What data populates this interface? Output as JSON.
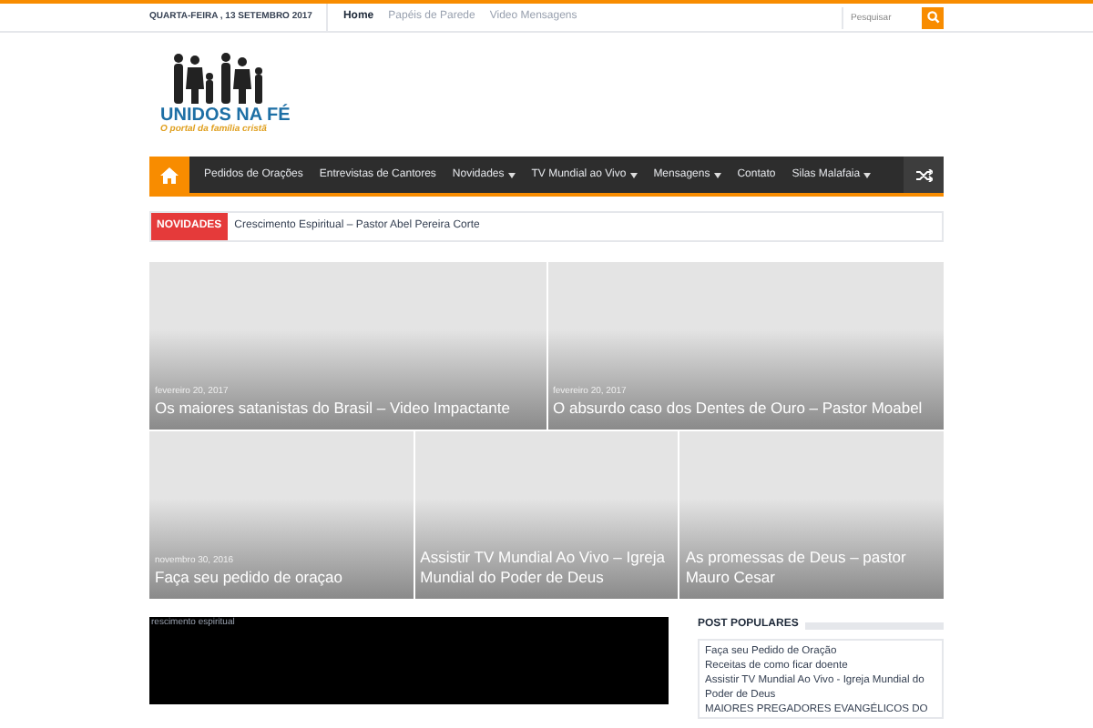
{
  "top_bar": {
    "date": "QUARTA-FEIRA , 13 SETEMBRO 2017",
    "links": [
      {
        "label": "Home",
        "selected": true
      },
      {
        "label": "Papéis de Parede",
        "selected": false
      },
      {
        "label": "Video Mensagens",
        "selected": false
      }
    ],
    "search": {
      "placeholder": "Pesquisar"
    }
  },
  "logo": {
    "title": "UNIDOS NA FÉ",
    "tagline": "O portal da família cristã"
  },
  "nav": {
    "items": [
      {
        "label": "Pedidos de Orações",
        "dropdown": false
      },
      {
        "label": "Entrevistas de Cantores",
        "dropdown": false
      },
      {
        "label": "Novidades",
        "dropdown": true
      },
      {
        "label": "TV Mundial ao Vivo",
        "dropdown": true
      },
      {
        "label": "Mensagens",
        "dropdown": true
      },
      {
        "label": "Contato",
        "dropdown": false
      },
      {
        "label": "Silas Malafaia",
        "dropdown": true
      }
    ]
  },
  "ticker": {
    "label": "NOVIDADES",
    "text": "Crescimento Espiritual – Pastor Abel Pereira Corte"
  },
  "featured": [
    [
      {
        "date": "fevereiro 20, 2017",
        "title": "Os maiores satanistas do Brasil – Video Impactante"
      },
      {
        "date": "fevereiro 20, 2017",
        "title": "O absurdo caso dos Dentes de Ouro – Pastor Moabel"
      }
    ],
    [
      {
        "date": "novembro 30, 2016",
        "title": "Faça seu pedido de oraçao"
      },
      {
        "title": "Assistir TV Mundial Ao Vivo – Igreja Mundial do Poder de Deus"
      },
      {
        "title": "As promessas de Deus – pastor Mauro Cesar"
      }
    ]
  ],
  "video": {
    "caption": "rescimento espiritual"
  },
  "sidebar": {
    "title": "POST POPULARES",
    "items": [
      "Faça seu Pedido de Oração",
      "Receitas de como ficar doente",
      "Assistir TV Mundial Ao Vivo - Igreja Mundial do Poder de Deus",
      "MAIORES PREGADORES EVANGÉLICOS DO"
    ]
  }
}
